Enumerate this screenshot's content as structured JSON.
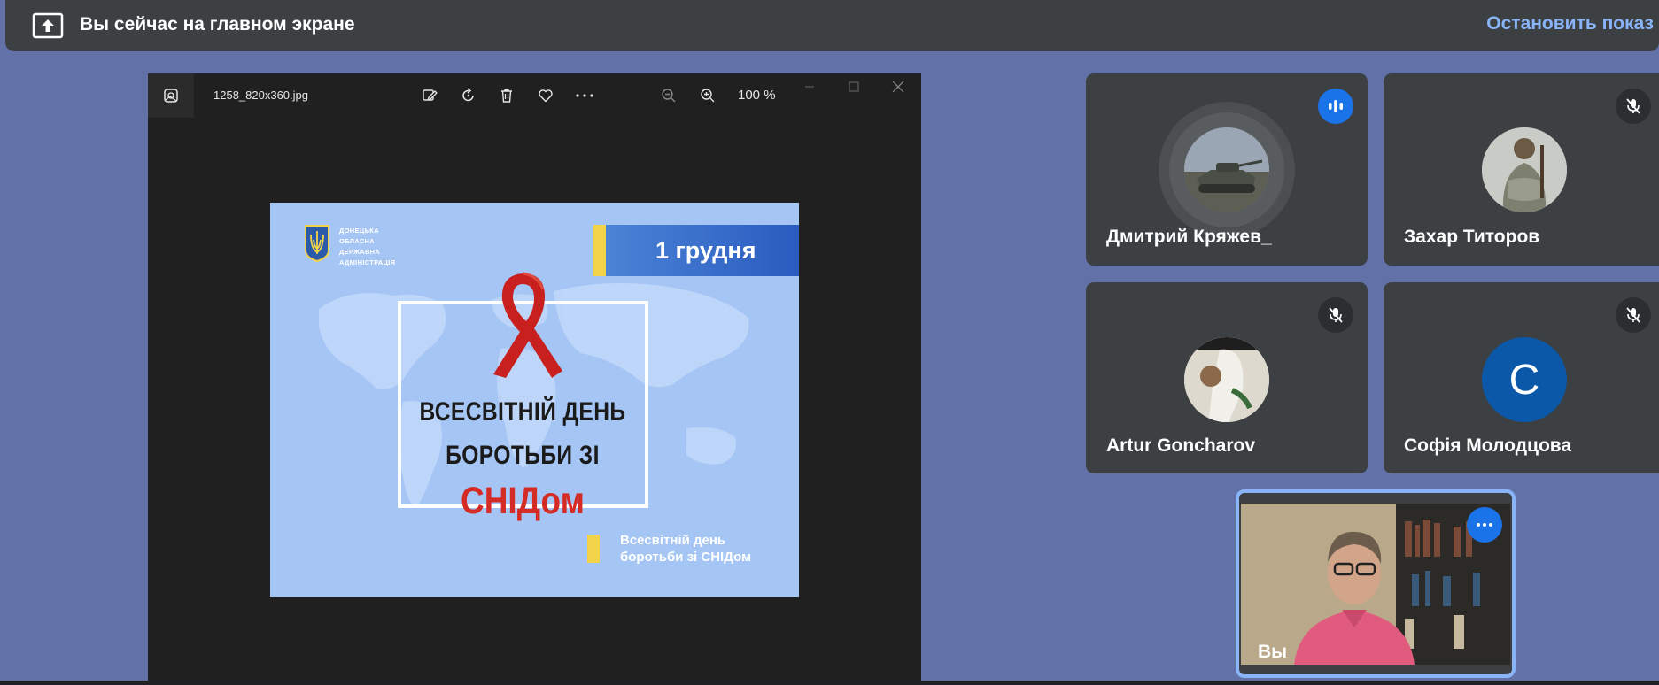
{
  "banner": {
    "text": "Вы сейчас на главном экране",
    "stop_label": "Остановить показ",
    "icon": "present-to-all-icon"
  },
  "viewer": {
    "filename": "1258_820x360.jpg",
    "zoom": "100 %",
    "toolbar_icons": [
      "edit-icon",
      "rotate-icon",
      "delete-icon",
      "favorite-icon",
      "more-icon",
      "zoom-out-icon",
      "zoom-in-icon"
    ],
    "window_icons": [
      "minimize-icon",
      "maximize-icon",
      "close-icon"
    ]
  },
  "poster": {
    "date": "1 грудня",
    "org": [
      "ДОНЕЦЬКА",
      "ОБЛАСНА",
      "ДЕРЖАВНА",
      "АДМІНІСТРАЦІЯ"
    ],
    "title_line1": "ВСЕСВІТНІЙ ДЕНЬ",
    "title_line2": "БОРОТЬБИ ЗІ",
    "title_line3": "СНІДом",
    "subtitle_line1": "Всесвітній день",
    "subtitle_line2": "боротьби зі СНІДом",
    "colors": {
      "background": "#a5c5f5",
      "accent_red": "#d42b25",
      "accent_yellow": "#f2d34a",
      "date_blue": "#2a5bbf"
    }
  },
  "participants": [
    {
      "name": "Дмитрий Кряжев_",
      "status": "speaking"
    },
    {
      "name": "Захар Титоров",
      "status": "muted"
    },
    {
      "name": "Artur Goncharov",
      "status": "muted"
    },
    {
      "name": "Софія Молодцова",
      "status": "muted",
      "initial": "С"
    }
  ],
  "self": {
    "name": "Вы"
  },
  "colors": {
    "page_bg": "#6272a8",
    "tile_bg": "#3c4043",
    "accent_blue": "#1a73e8",
    "link_blue": "#8ab4f8"
  }
}
